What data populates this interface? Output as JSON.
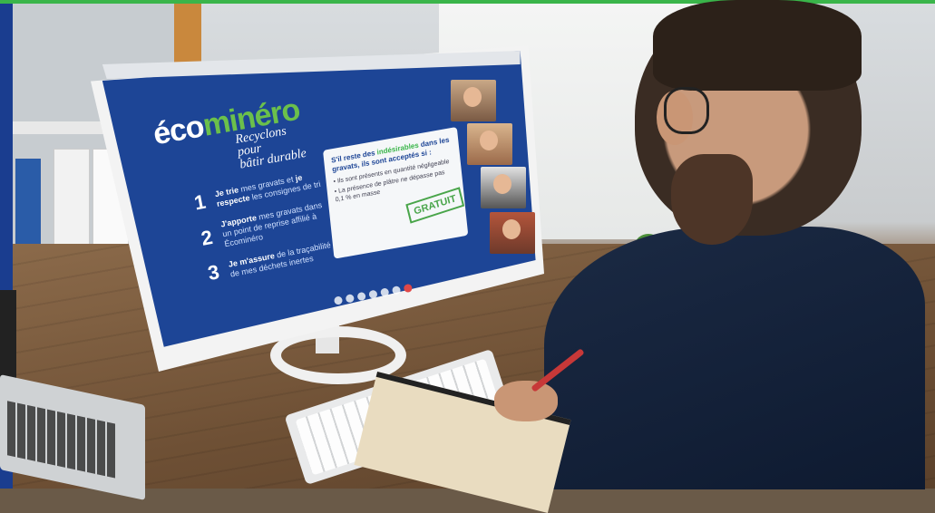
{
  "brand": {
    "name_part1": "éco",
    "name_part2": "minéro",
    "tagline_line1": "Recyclons pour",
    "tagline_line2": "bâtir durable"
  },
  "steps": [
    {
      "number": "1",
      "bold1": "Je trie",
      "text1": " mes gravats et ",
      "bold2": "je respecte",
      "text2": " les consignes de tri"
    },
    {
      "number": "2",
      "bold1": "J'apporte",
      "text1": " mes gravats dans un point de reprise affilié à Écominéro",
      "bold2": "",
      "text2": ""
    },
    {
      "number": "3",
      "bold1": "Je m'assure",
      "text1": " de la traçabilité de mes déchets inertes",
      "bold2": "",
      "text2": ""
    }
  ],
  "info_card": {
    "title_part1": "S'il reste des ",
    "title_highlight": "indésirables",
    "title_part2": " dans les gravats, ils sont acceptés si :",
    "bullets": [
      "Ils sont présents en quantité négligeable",
      "La présence de plâtre ne dépasse pas 0,1 % en masse"
    ],
    "stamp": "GRATUIT"
  },
  "colors": {
    "accent_green": "#3ab54a",
    "brand_blue": "#1d4596"
  }
}
